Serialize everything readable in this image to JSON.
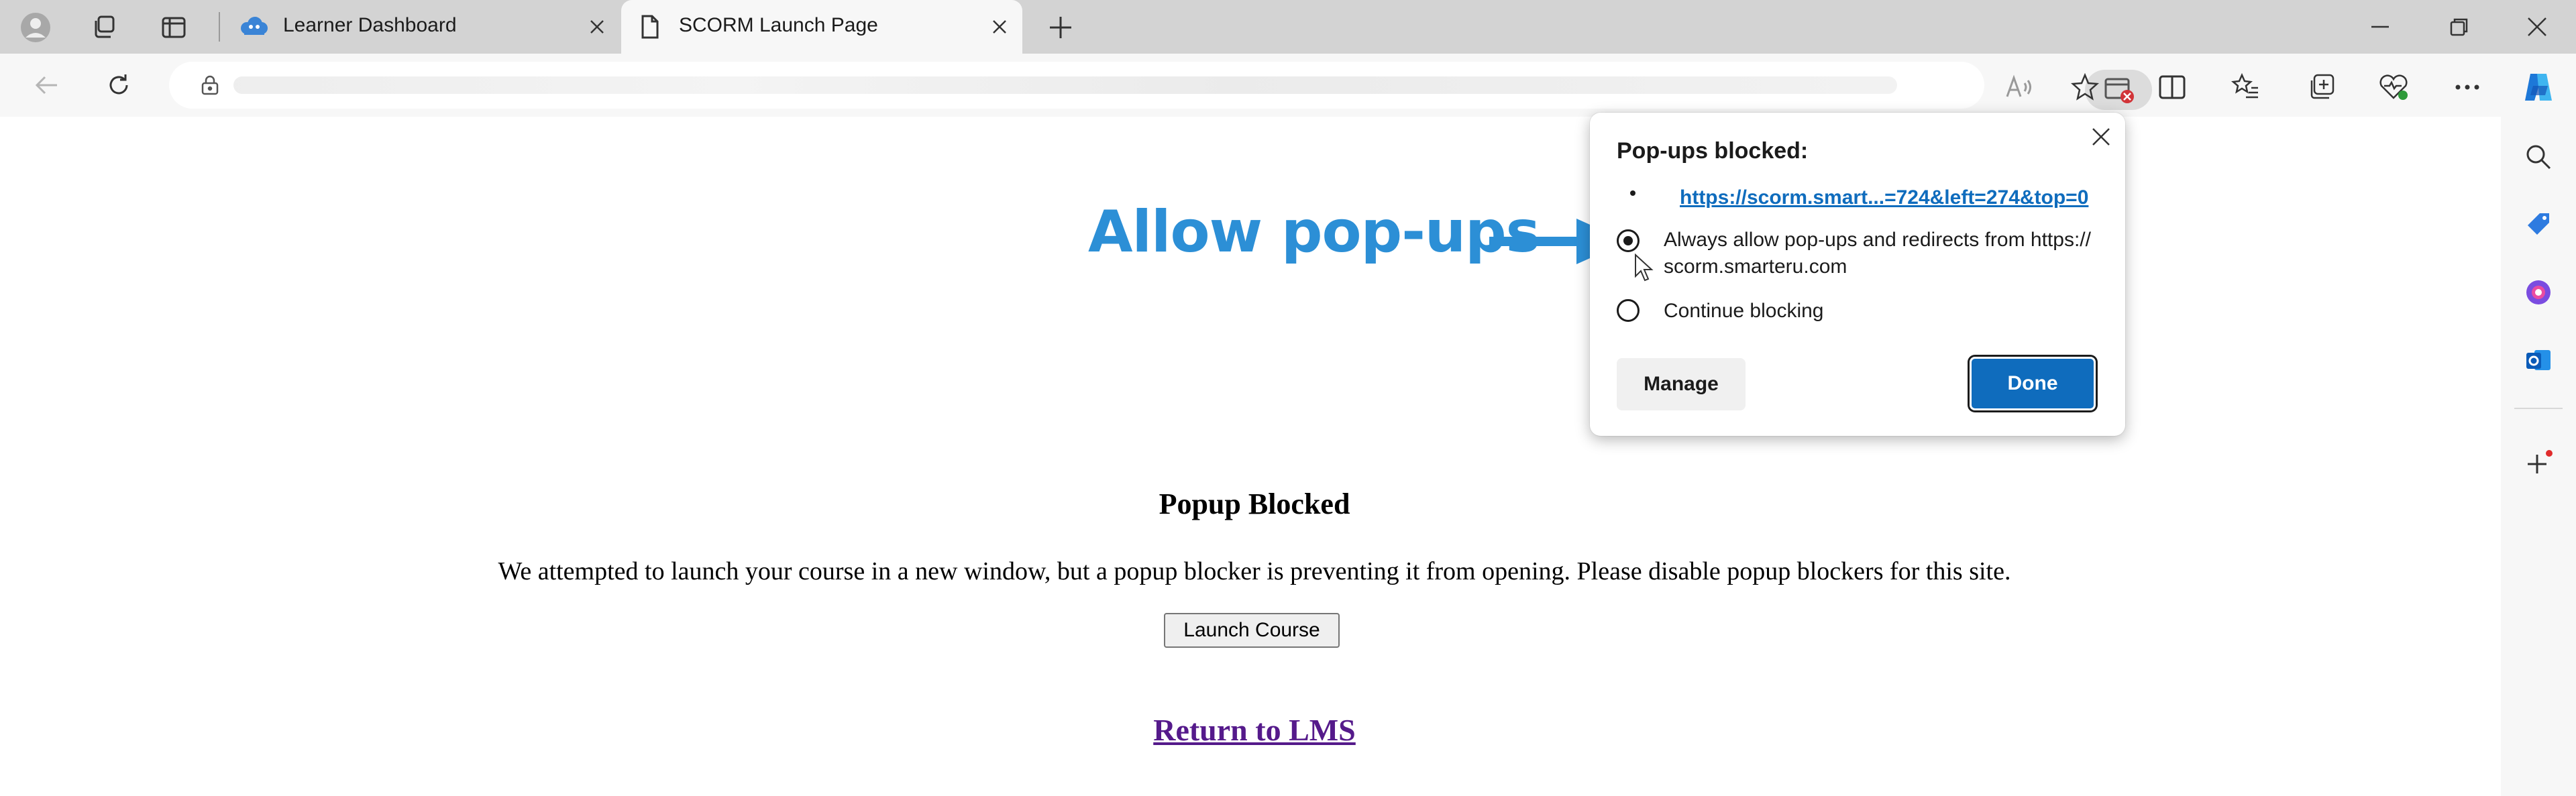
{
  "tabs": [
    {
      "title": "Learner Dashboard",
      "favicon": "cloud-people-icon"
    },
    {
      "title": "SCORM Launch Page",
      "favicon": "page-icon"
    }
  ],
  "page": {
    "title": "Popup Blocked",
    "message": "We attempted to launch your course in a new window, but a popup blocker is preventing it from opening. Please disable popup blockers for this site.",
    "launch_button": "Launch Course",
    "return_link": "Return to LMS"
  },
  "annotation": {
    "text": "Allow pop-ups",
    "color": "#2c8fd6"
  },
  "popup": {
    "title": "Pop-ups blocked:",
    "blocked_link": "https://scorm.smart...=724&left=274&top=0",
    "option_allow_line1": "Always allow pop-ups and redirects from https://",
    "option_allow_line2": "scorm.smarteru.com",
    "option_block": "Continue blocking",
    "selected_option": "allow",
    "manage_button": "Manage",
    "done_button": "Done"
  },
  "colors": {
    "accent": "#0f6cbd",
    "visited_link": "#551a8b",
    "annotation": "#2c8fd6"
  }
}
